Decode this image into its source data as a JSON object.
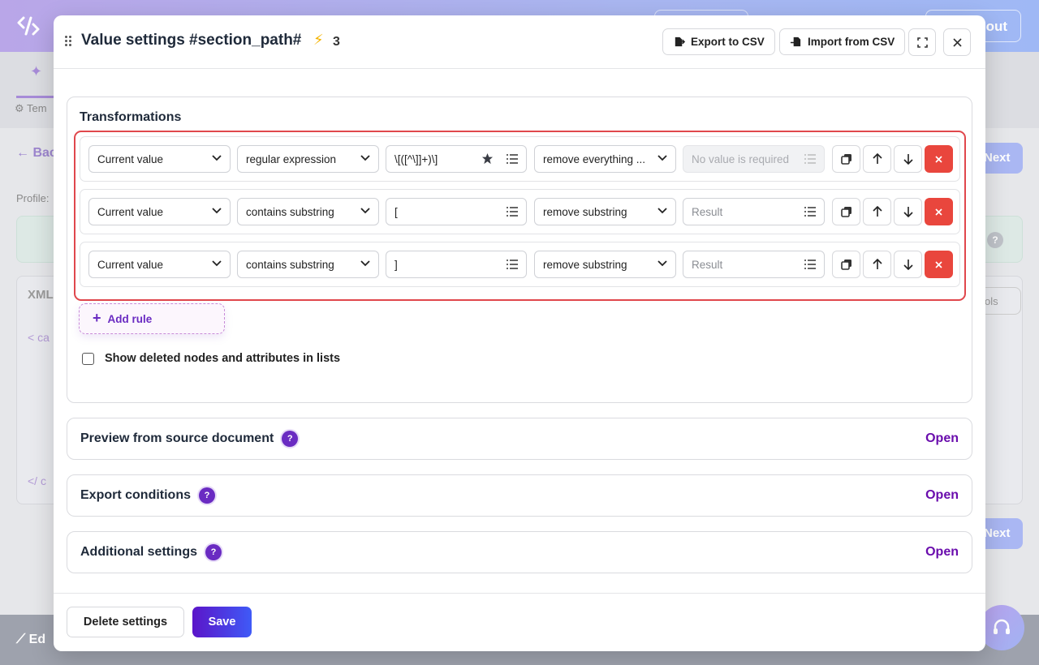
{
  "background": {
    "logout_label": "out",
    "template_tab": "Tem",
    "back_label": "Bac",
    "profile_label": "Profile:",
    "xml_label": "XML",
    "next_label": "Next",
    "tools_label": "ols",
    "footer_label": "Ed",
    "code_open": "< ca",
    "code_close": "</ c"
  },
  "modal": {
    "title": "Value settings #section_path#",
    "bolt_count": "3",
    "export_csv_label": "Export to CSV",
    "import_csv_label": "Import from CSV"
  },
  "transformations": {
    "title": "Transformations",
    "rules": [
      {
        "source": "Current value",
        "condition": "regular expression",
        "pattern": "\\[([^\\]]+)\\]",
        "action": "remove everything ...",
        "result_placeholder": "No value is required"
      },
      {
        "source": "Current value",
        "condition": "contains substring",
        "pattern": "[",
        "action": "remove substring",
        "result_placeholder": "Result"
      },
      {
        "source": "Current value",
        "condition": "contains substring",
        "pattern": "]",
        "action": "remove substring",
        "result_placeholder": "Result"
      }
    ],
    "add_rule_label": "Add rule",
    "show_deleted_label": "Show deleted nodes and attributes in lists"
  },
  "accordions": {
    "preview": {
      "title": "Preview from source document",
      "open_label": "Open"
    },
    "export_conditions": {
      "title": "Export conditions",
      "open_label": "Open"
    },
    "additional": {
      "title": "Additional settings",
      "open_label": "Open"
    },
    "help_glyph": "?"
  },
  "footer": {
    "delete_label": "Delete settings",
    "save_label": "Save"
  },
  "colors": {
    "accent": "#6a2bc2",
    "delete_red": "#e9463d",
    "highlight_border": "#e0474c"
  }
}
